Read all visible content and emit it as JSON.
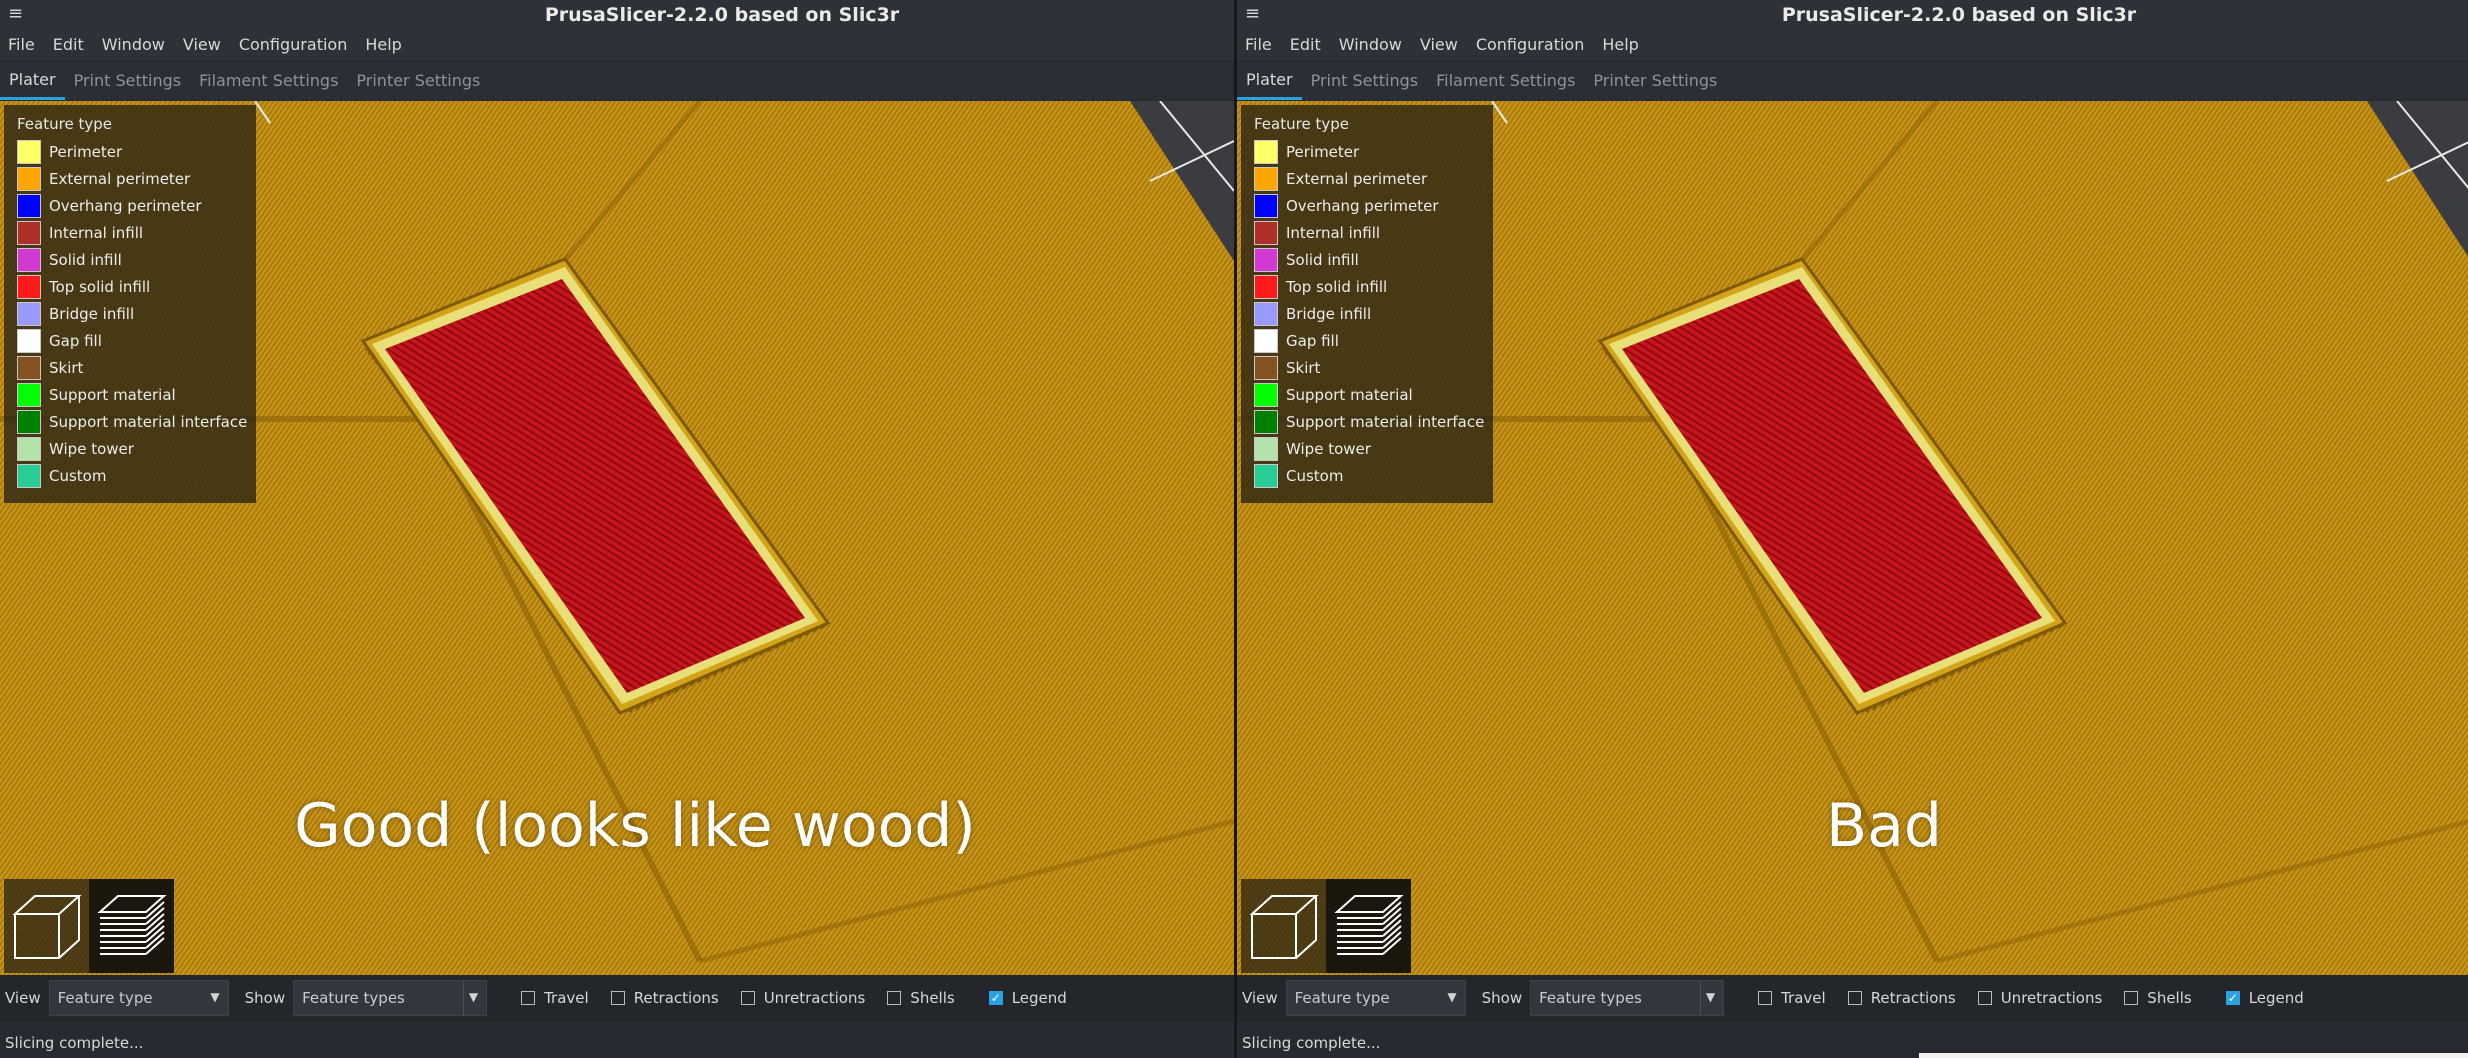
{
  "panes": [
    {
      "title": "PrusaSlicer-2.2.0 based on Slic3r",
      "menu": [
        "File",
        "Edit",
        "Window",
        "View",
        "Configuration",
        "Help"
      ],
      "tabs": [
        "Plater",
        "Print Settings",
        "Filament Settings",
        "Printer Settings"
      ],
      "active_tab": "Plater",
      "legend": {
        "title": "Feature type",
        "items": [
          {
            "label": "Perimeter",
            "color": "#ffff66"
          },
          {
            "label": "External perimeter",
            "color": "#ffa500"
          },
          {
            "label": "Overhang perimeter",
            "color": "#0000ff"
          },
          {
            "label": "Internal infill",
            "color": "#b03029"
          },
          {
            "label": "Solid infill",
            "color": "#d23bd2"
          },
          {
            "label": "Top solid infill",
            "color": "#ff1a1a"
          },
          {
            "label": "Bridge infill",
            "color": "#9999ff"
          },
          {
            "label": "Gap fill",
            "color": "#ffffff"
          },
          {
            "label": "Skirt",
            "color": "#845321"
          },
          {
            "label": "Support material",
            "color": "#00ff00"
          },
          {
            "label": "Support material interface",
            "color": "#008000"
          },
          {
            "label": "Wipe tower",
            "color": "#b3e3ab"
          },
          {
            "label": "Custom",
            "color": "#28cc94"
          }
        ]
      },
      "overlay_label": "Good (looks like wood)",
      "view_label": "View",
      "view_value": "Feature type",
      "show_label": "Show",
      "show_value": "Feature types",
      "checkboxes": [
        {
          "label": "Travel",
          "checked": false
        },
        {
          "label": "Retractions",
          "checked": false
        },
        {
          "label": "Unretractions",
          "checked": false
        },
        {
          "label": "Shells",
          "checked": false
        },
        {
          "label": "Legend",
          "checked": true
        }
      ],
      "status": "Slicing complete..."
    },
    {
      "title": "PrusaSlicer-2.2.0 based on Slic3r",
      "menu": [
        "File",
        "Edit",
        "Window",
        "View",
        "Configuration",
        "Help"
      ],
      "tabs": [
        "Plater",
        "Print Settings",
        "Filament Settings",
        "Printer Settings"
      ],
      "active_tab": "Plater",
      "legend": {
        "title": "Feature type",
        "items": [
          {
            "label": "Perimeter",
            "color": "#ffff66"
          },
          {
            "label": "External perimeter",
            "color": "#ffa500"
          },
          {
            "label": "Overhang perimeter",
            "color": "#0000ff"
          },
          {
            "label": "Internal infill",
            "color": "#b03029"
          },
          {
            "label": "Solid infill",
            "color": "#d23bd2"
          },
          {
            "label": "Top solid infill",
            "color": "#ff1a1a"
          },
          {
            "label": "Bridge infill",
            "color": "#9999ff"
          },
          {
            "label": "Gap fill",
            "color": "#ffffff"
          },
          {
            "label": "Skirt",
            "color": "#845321"
          },
          {
            "label": "Support material",
            "color": "#00ff00"
          },
          {
            "label": "Support material interface",
            "color": "#008000"
          },
          {
            "label": "Wipe tower",
            "color": "#b3e3ab"
          },
          {
            "label": "Custom",
            "color": "#28cc94"
          }
        ]
      },
      "overlay_label": "Bad",
      "view_label": "View",
      "view_value": "Feature type",
      "show_label": "Show",
      "show_value": "Feature types",
      "checkboxes": [
        {
          "label": "Travel",
          "checked": false
        },
        {
          "label": "Retractions",
          "checked": false
        },
        {
          "label": "Unretractions",
          "checked": false
        },
        {
          "label": "Shells",
          "checked": false
        },
        {
          "label": "Legend",
          "checked": true
        }
      ],
      "status": "Slicing complete..."
    }
  ],
  "icons": {
    "hamburger": "hamburger-menu-icon",
    "iso_view": "isometric-cube-icon",
    "layers_view": "layers-stack-icon"
  }
}
